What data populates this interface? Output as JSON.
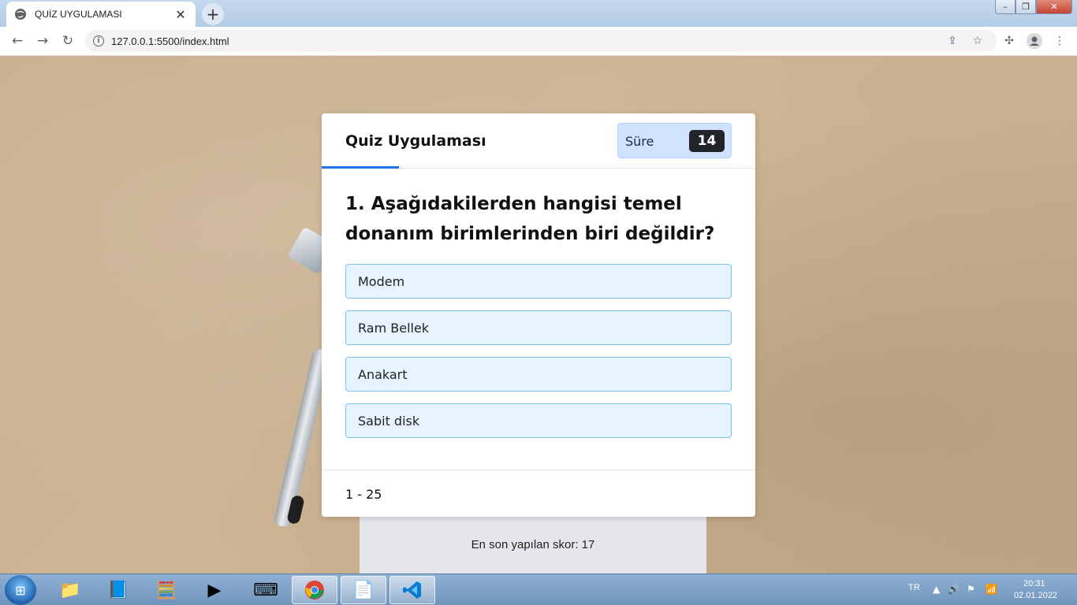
{
  "browser": {
    "tab_title": "QUİZ UYGULAMASI",
    "url": "127.0.0.1:5500/index.html"
  },
  "quiz": {
    "title": "Quiz Uygulaması",
    "timer_label": "Süre",
    "timer_value": "14",
    "question": "1. Aşağıdakilerden hangisi temel donanım birimlerinden biri değildir?",
    "options": [
      "Modem",
      "Ram Bellek",
      "Anakart",
      "Sabit disk"
    ],
    "progress": "1 - 25",
    "last_score": "En son yapılan skor: 17"
  },
  "taskbar": {
    "language": "TR",
    "time": "20:31",
    "date": "02.01.2022"
  },
  "colors": {
    "accent": "#1a73e8",
    "option_bg": "#e7f3ff",
    "option_border": "#7ec3e6",
    "timer_bg": "#cfe2ff",
    "timer_badge": "#212529"
  }
}
